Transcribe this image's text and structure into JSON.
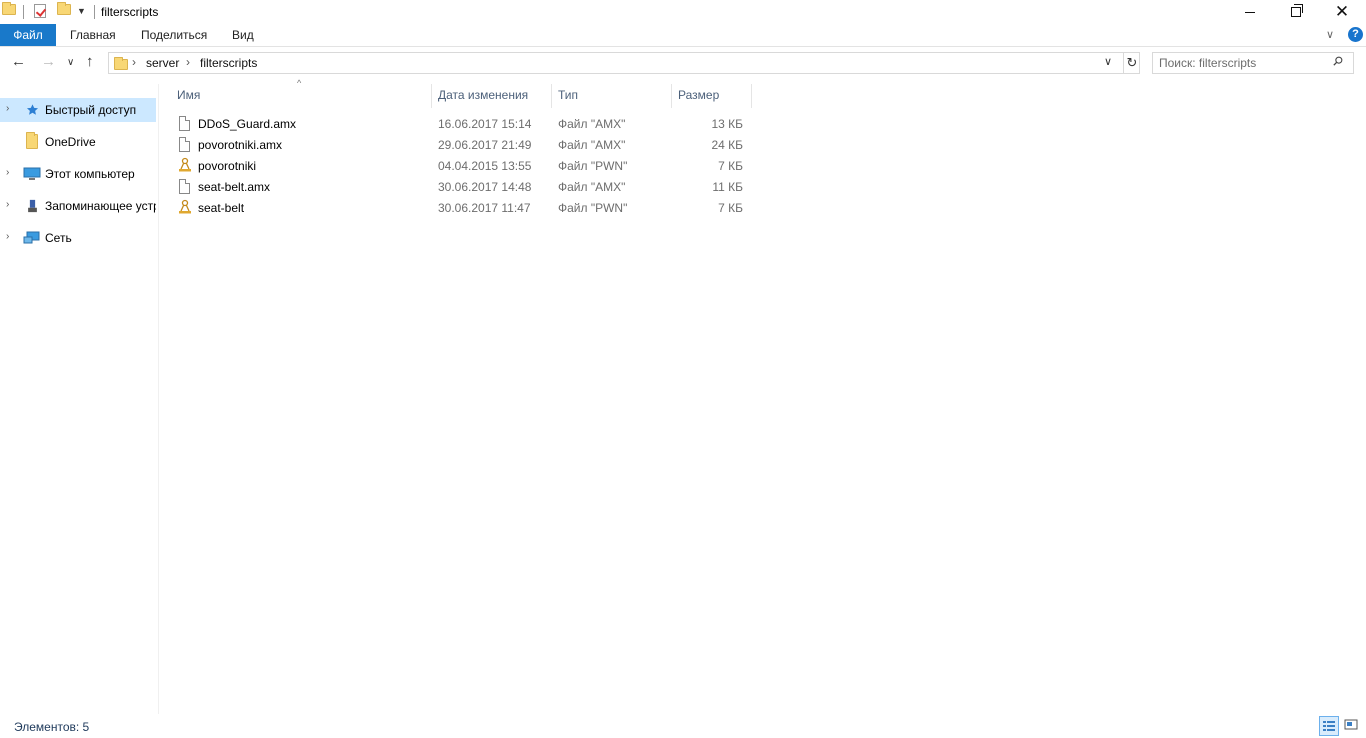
{
  "window": {
    "title": "filterscripts"
  },
  "ribbon": {
    "tabs": [
      {
        "label": "Файл"
      },
      {
        "label": "Главная"
      },
      {
        "label": "Поделиться"
      },
      {
        "label": "Вид"
      }
    ],
    "help_label": "?"
  },
  "address": {
    "crumbs": [
      "server",
      "filterscripts"
    ]
  },
  "search": {
    "placeholder": "Поиск: filterscripts"
  },
  "sidebar": {
    "items": [
      {
        "label": "Быстрый доступ",
        "icon": "star-icon",
        "selected": true
      },
      {
        "label": "OneDrive",
        "icon": "folder-icon"
      },
      {
        "label": "Этот компьютер",
        "icon": "computer-icon"
      },
      {
        "label": "Запоминающее устройство",
        "icon": "usb-drive-icon"
      },
      {
        "label": "Сеть",
        "icon": "network-icon"
      }
    ]
  },
  "columns": {
    "name": "Имя",
    "date": "Дата изменения",
    "type": "Тип",
    "size": "Размер"
  },
  "files": [
    {
      "name": "DDoS_Guard.amx",
      "date": "16.06.2017 15:14",
      "type": "Файл \"AMX\"",
      "size": "13 КБ",
      "icon": "file-icon"
    },
    {
      "name": "povorotniki.amx",
      "date": "29.06.2017 21:49",
      "type": "Файл \"AMX\"",
      "size": "24 КБ",
      "icon": "file-icon"
    },
    {
      "name": "povorotniki",
      "date": "04.04.2015 13:55",
      "type": "Файл \"PWN\"",
      "size": "7 КБ",
      "icon": "pawn-icon"
    },
    {
      "name": "seat-belt.amx",
      "date": "30.06.2017 14:48",
      "type": "Файл \"AMX\"",
      "size": "11 КБ",
      "icon": "file-icon"
    },
    {
      "name": "seat-belt",
      "date": "30.06.2017 11:47",
      "type": "Файл \"PWN\"",
      "size": "7 КБ",
      "icon": "pawn-icon"
    }
  ],
  "status": {
    "items_count": "Элементов: 5"
  },
  "colors": {
    "accent": "#1979ca",
    "selection": "#cce8ff"
  }
}
